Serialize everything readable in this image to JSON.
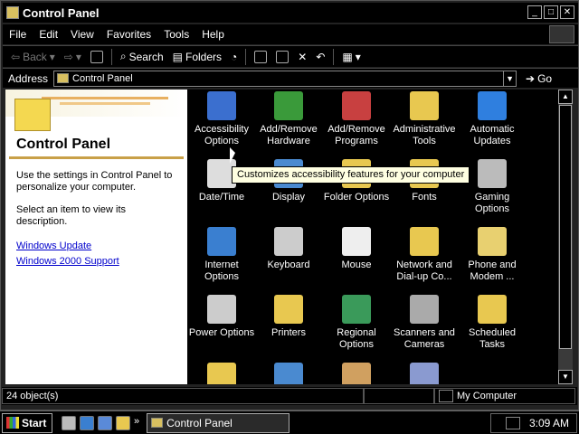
{
  "window": {
    "title": "Control Panel"
  },
  "menu": [
    "File",
    "Edit",
    "View",
    "Favorites",
    "Tools",
    "Help"
  ],
  "toolbar": {
    "back": "Back",
    "search": "Search",
    "folders": "Folders"
  },
  "address": {
    "label": "Address",
    "value": "Control Panel",
    "go": "Go"
  },
  "left_pane": {
    "title": "Control Panel",
    "description": "Use the settings in Control Panel to personalize your computer.",
    "hint": "Select an item to view its description.",
    "links": [
      "Windows Update",
      "Windows 2000 Support"
    ]
  },
  "items": [
    {
      "label": "Accessibility Options",
      "icon": "accessibility-icon",
      "color": "#3b6fcf"
    },
    {
      "label": "Add/Remove Hardware",
      "icon": "add-hardware-icon",
      "color": "#3a9a3a"
    },
    {
      "label": "Add/Remove Programs",
      "icon": "add-programs-icon",
      "color": "#c84040"
    },
    {
      "label": "Administrative Tools",
      "icon": "admin-tools-icon",
      "color": "#e8c850"
    },
    {
      "label": "Automatic Updates",
      "icon": "updates-icon",
      "color": "#2f7fdf"
    },
    {
      "label": "Date/Time",
      "icon": "datetime-icon",
      "color": "#dddddd"
    },
    {
      "label": "Display",
      "icon": "display-icon",
      "color": "#4a8ad0"
    },
    {
      "label": "Folder Options",
      "icon": "folder-options-icon",
      "color": "#e8c850"
    },
    {
      "label": "Fonts",
      "icon": "fonts-icon",
      "color": "#e8c850"
    },
    {
      "label": "Gaming Options",
      "icon": "gaming-icon",
      "color": "#bbbbbb"
    },
    {
      "label": "Internet Options",
      "icon": "internet-icon",
      "color": "#3a7fd0"
    },
    {
      "label": "Keyboard",
      "icon": "keyboard-icon",
      "color": "#cccccc"
    },
    {
      "label": "Mouse",
      "icon": "mouse-icon",
      "color": "#eeeeee"
    },
    {
      "label": "Network and Dial-up Co...",
      "icon": "network-icon",
      "color": "#e8c850"
    },
    {
      "label": "Phone and Modem ...",
      "icon": "phone-icon",
      "color": "#e8d070"
    },
    {
      "label": "Power Options",
      "icon": "power-icon",
      "color": "#cccccc"
    },
    {
      "label": "Printers",
      "icon": "printers-icon",
      "color": "#e8c850"
    },
    {
      "label": "Regional Options",
      "icon": "regional-icon",
      "color": "#3a9a5a"
    },
    {
      "label": "Scanners and Cameras",
      "icon": "scanner-icon",
      "color": "#aaaaaa"
    },
    {
      "label": "Scheduled Tasks",
      "icon": "scheduled-icon",
      "color": "#e8c850"
    },
    {
      "label": "",
      "icon": "sounds-icon",
      "color": "#e8c850"
    },
    {
      "label": "",
      "icon": "system-icon",
      "color": "#4a8ad0"
    },
    {
      "label": "",
      "icon": "users-icon",
      "color": "#d0a060"
    },
    {
      "label": "",
      "icon": "other-icon",
      "color": "#8a9ad0"
    }
  ],
  "tooltip": "Customizes accessibility features for your computer",
  "status": {
    "count": "24 object(s)",
    "zone": "My Computer"
  },
  "taskbar": {
    "start": "Start",
    "task": "Control Panel",
    "clock": "3:09 AM"
  }
}
